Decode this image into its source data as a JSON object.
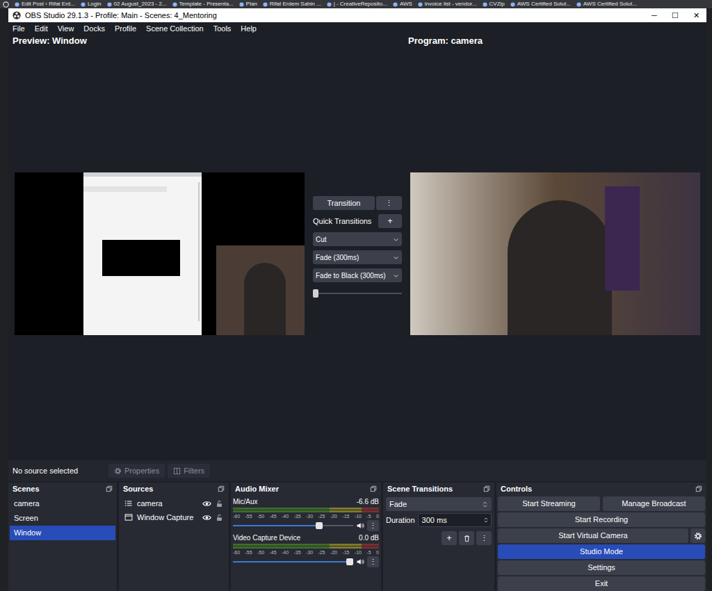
{
  "bookmarks": [
    "Edit Post ‹ Rifat Erd...",
    "Login",
    "02 August_2023 - 2...",
    "Template - Presenta...",
    "Plan",
    "Rifat Erdem Sahin ...",
    "| - CreativeReposito...",
    "AWS",
    "invoice list - vendor...",
    "CVZip",
    "AWS Certified Solut...",
    "AWS Certified Solut..."
  ],
  "window": {
    "title": "OBS Studio 29.1.3 - Profile: Main - Scenes: 4_Mentoring",
    "controls": [
      "─",
      "☐",
      "✕"
    ]
  },
  "menu": [
    "File",
    "Edit",
    "View",
    "Docks",
    "Profile",
    "Scene Collection",
    "Tools",
    "Help"
  ],
  "preview": {
    "label": "Preview: Window"
  },
  "program": {
    "label": "Program: camera"
  },
  "transitions_panel": {
    "transition": "Transition",
    "more": "⋮",
    "quick_label": "Quick Transitions",
    "add": "+",
    "quick": [
      "Cut",
      "Fade (300ms)",
      "Fade to Black (300ms)"
    ],
    "t_bar": {
      "level": 0
    }
  },
  "source_toolbar": {
    "status": "No source selected",
    "properties": {
      "label": "Properties",
      "disabled": true
    },
    "filters": {
      "label": "Filters",
      "disabled": true
    }
  },
  "scenes": {
    "title": "Scenes",
    "items": [
      {
        "label": "camera",
        "selected": false
      },
      {
        "label": "Screen",
        "selected": false
      },
      {
        "label": "Window",
        "selected": true
      }
    ]
  },
  "sources": {
    "title": "Sources",
    "items": [
      {
        "label": "camera",
        "kind": "list",
        "visible": true,
        "locked": false
      },
      {
        "label": "Window Capture",
        "kind": "window",
        "visible": true,
        "locked": false
      }
    ]
  },
  "audio_mixer": {
    "title": "Audio Mixer",
    "scale": [
      "-60",
      "-55",
      "-50",
      "-45",
      "-40",
      "-35",
      "-30",
      "-25",
      "-20",
      "-15",
      "-10",
      "-5",
      "0"
    ],
    "channels": [
      {
        "name": "Mic/Aux",
        "reading": "-6.6 dB",
        "level": 0.73,
        "muted": false,
        "menu": "⋮"
      },
      {
        "name": "Video Capture Device",
        "reading": "0.0 dB",
        "level": 1,
        "muted": false,
        "menu": "⋮"
      }
    ]
  },
  "scene_transitions": {
    "title": "Scene Transitions",
    "transition": "Fade",
    "duration_label": "Duration",
    "duration": "300 ms",
    "add": "+",
    "more": "⋮"
  },
  "controls": {
    "title": "Controls",
    "buttons": [
      {
        "label": "Start Streaming",
        "active": false
      },
      {
        "label": "Manage Broadcast",
        "active": false
      },
      {
        "label": "Start Recording",
        "active": false
      },
      {
        "label": "Start Virtual Camera",
        "active": false
      },
      {
        "label": "Studio Mode",
        "active": true
      },
      {
        "label": "Settings",
        "active": false
      },
      {
        "label": "Exit",
        "active": false
      }
    ]
  }
}
